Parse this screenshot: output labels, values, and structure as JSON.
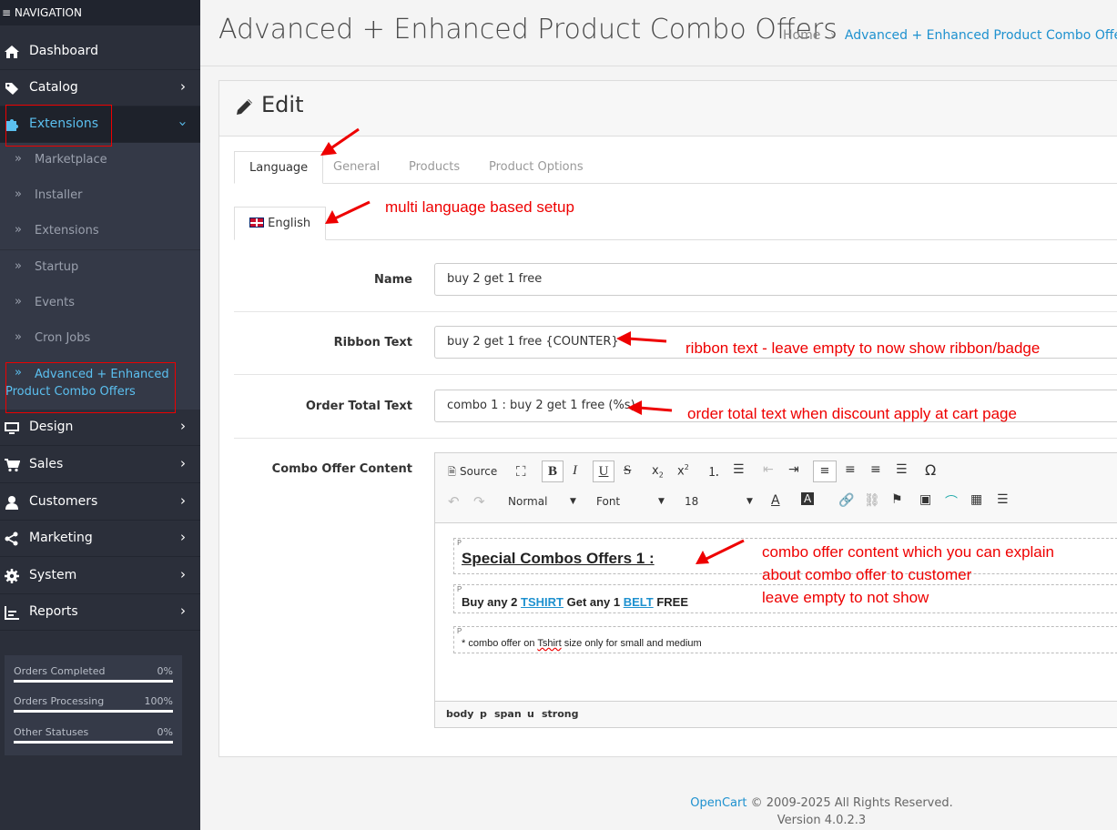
{
  "sidebar": {
    "title": "NAVIGATION",
    "items": [
      {
        "label": "Dashboard",
        "icon": "home-icon"
      },
      {
        "label": "Catalog",
        "icon": "tag-icon"
      },
      {
        "label": "Extensions",
        "icon": "puzzle-icon"
      },
      {
        "label": "Design",
        "icon": "monitor-icon"
      },
      {
        "label": "Sales",
        "icon": "cart-icon"
      },
      {
        "label": "Customers",
        "icon": "user-icon"
      },
      {
        "label": "Marketing",
        "icon": "share-icon"
      },
      {
        "label": "System",
        "icon": "gear-icon"
      },
      {
        "label": "Reports",
        "icon": "bar-chart-icon"
      }
    ],
    "sub_items": [
      "Marketplace",
      "Installer",
      "Extensions",
      "Startup",
      "Events",
      "Cron Jobs",
      "Advanced + Enhanced",
      "Product Combo Offers"
    ],
    "stats": [
      {
        "label": "Orders Completed",
        "value": "0%"
      },
      {
        "label": "Orders Processing",
        "value": "100%"
      },
      {
        "label": "Other Statuses",
        "value": "0%"
      }
    ]
  },
  "header": {
    "title": "Advanced + Enhanced Product Combo Offers",
    "breadcrumb_home": "Home",
    "breadcrumb_sep": "›",
    "breadcrumb_current": "Advanced + Enhanced Product Combo Offers"
  },
  "card": {
    "title": "Edit",
    "tabs": [
      "Language",
      "General",
      "Products",
      "Product Options"
    ],
    "language_tab": "English",
    "fields": {
      "name_label": "Name",
      "name_value": "buy 2 get 1 free",
      "ribbon_label": "Ribbon Text",
      "ribbon_value": "buy 2 get 1 free {COUNTER}",
      "order_label": "Order Total Text",
      "order_value": "combo 1 : buy 2 get 1 free (%s)",
      "content_label": "Combo Offer Content"
    },
    "editor": {
      "source_label": "Source",
      "format_select": "Normal",
      "font_select": "Font",
      "size_select": "18",
      "p_marker": "P",
      "heading": "Special Combos Offers 1 :",
      "line2_a": "Buy any 2 ",
      "line2_link1": "TSHIRT",
      "line2_b": " Get any 1 ",
      "line2_link2": "BELT",
      "line2_c": " FREE",
      "line3_a": "* combo offer on ",
      "line3_misspelled": "Tshirt",
      "line3_b": " size only for small and medium",
      "path": [
        "body",
        "p",
        "span",
        "u",
        "strong"
      ]
    }
  },
  "annotations": {
    "multi_language": "multi language based setup",
    "ribbon": "ribbon text - leave empty to now show ribbon/badge",
    "order_total": "order total text when discount apply at cart page",
    "content_1": "combo offer content which you can explain",
    "content_2": "about combo offer to customer",
    "content_3": "leave empty to not show"
  },
  "footer": {
    "brand": "OpenCart",
    "copyright": " © 2009-2025 All Rights Reserved.",
    "version": "Version 4.0.2.3"
  },
  "colors": {
    "accent": "#1e91cf",
    "sidebar": "#2b2f3a",
    "annotation": "#ee0000"
  }
}
